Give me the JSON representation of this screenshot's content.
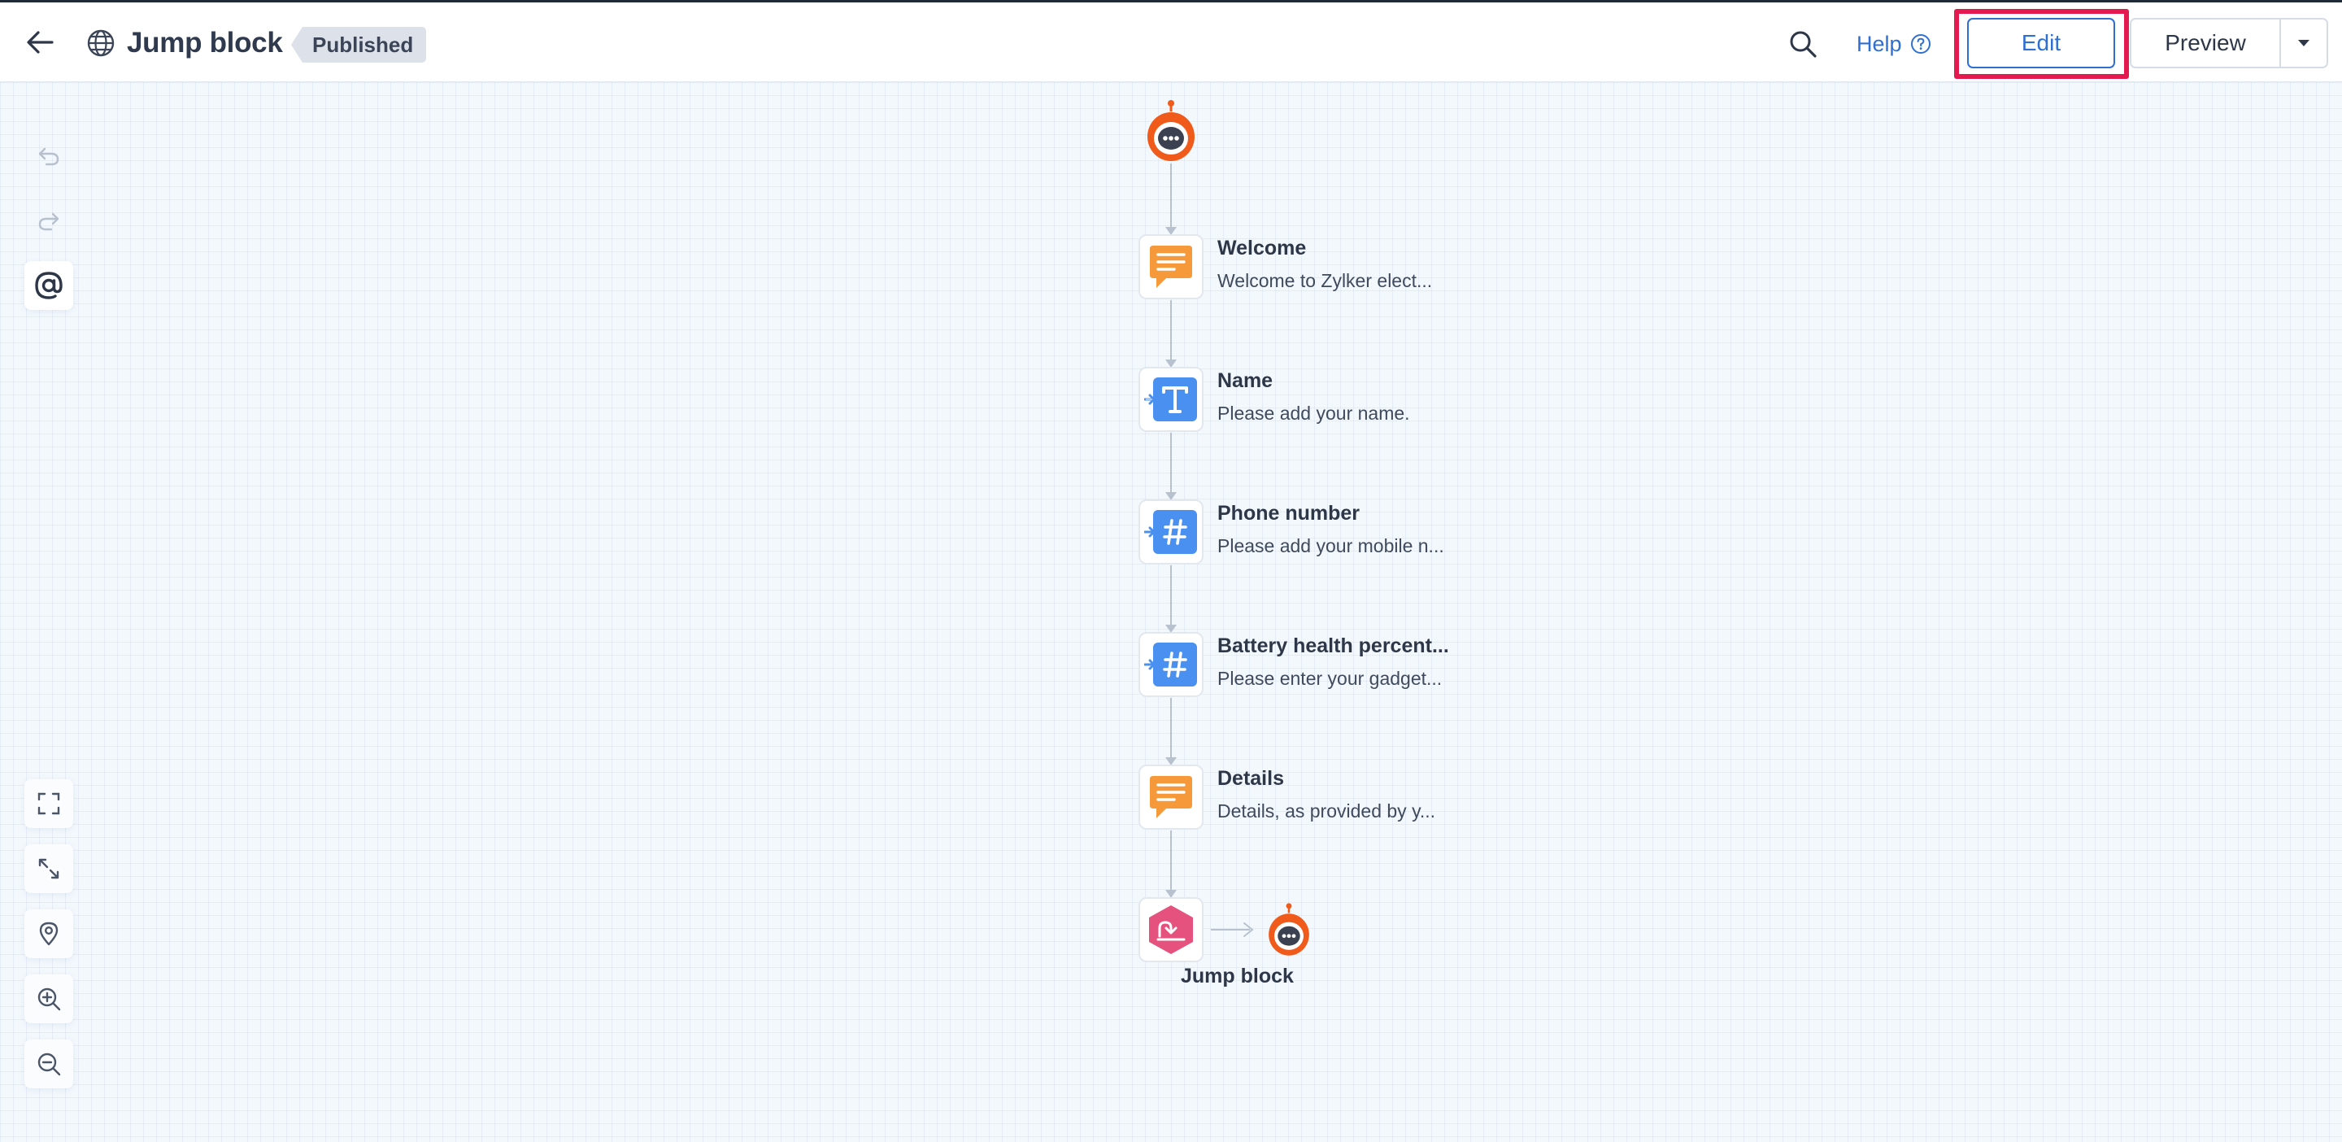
{
  "header": {
    "title": "Jump block",
    "status_badge": "Published",
    "help_label": "Help",
    "edit_label": "Edit",
    "preview_label": "Preview"
  },
  "flow": {
    "nodes": [
      {
        "title": "Welcome",
        "subtitle": "Welcome to Zylker elect...",
        "icon": "message-icon"
      },
      {
        "title": "Name",
        "subtitle": "Please add your name.",
        "icon": "text-input-icon"
      },
      {
        "title": "Phone number",
        "subtitle": "Please add your mobile n...",
        "icon": "number-input-icon"
      },
      {
        "title": "Battery health percent...",
        "subtitle": "Please enter your gadget...",
        "icon": "number-input-icon"
      },
      {
        "title": "Details",
        "subtitle": "Details, as provided by y...",
        "icon": "message-icon"
      }
    ],
    "jump_node": {
      "label": "Jump block",
      "icon": "jump-icon"
    }
  },
  "colors": {
    "accent": "#2f6fd2",
    "highlight": "#e3194f",
    "bot_orange": "#f05a1a",
    "message_orange": "#f6993a",
    "input_blue": "#4a90f0",
    "jump_pink": "#e5527e"
  }
}
